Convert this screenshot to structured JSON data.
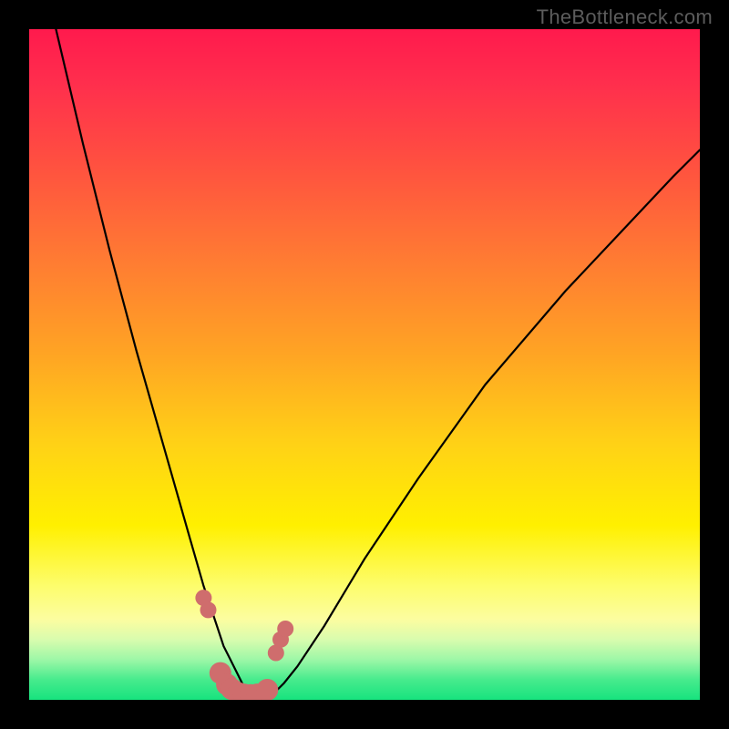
{
  "watermark": "TheBottleneck.com",
  "chart_data": {
    "type": "line",
    "title": "",
    "xlabel": "",
    "ylabel": "",
    "xlim": [
      0,
      100
    ],
    "ylim": [
      0,
      100
    ],
    "series": [
      {
        "name": "curve",
        "x": [
          4,
          8,
          12,
          16,
          20,
          24,
          26,
          28,
          29,
          30,
          31,
          32,
          33,
          34,
          35,
          36,
          37,
          38,
          40,
          44,
          50,
          58,
          68,
          80,
          96,
          100
        ],
        "values": [
          100,
          83,
          67,
          52,
          38,
          24,
          17,
          11,
          8,
          6,
          4,
          2,
          1,
          0.5,
          0.5,
          1,
          1.5,
          2.5,
          5,
          11,
          21,
          33,
          47,
          61,
          78,
          82
        ]
      }
    ],
    "markers": {
      "name": "threshold-dots",
      "x": [
        26.0,
        26.7,
        28.5,
        29.5,
        30.2,
        31.2,
        32.0,
        33.0,
        34.0,
        35.5,
        36.8,
        37.5,
        38.2
      ],
      "values": [
        15.2,
        13.4,
        4.0,
        2.3,
        1.6,
        1.0,
        0.8,
        0.7,
        0.8,
        1.5,
        7.0,
        9.0,
        10.6
      ],
      "radius": [
        9,
        9,
        12,
        12,
        12,
        12,
        12,
        12,
        12,
        12,
        9,
        9,
        9
      ],
      "color": "#cf6d6d"
    }
  }
}
